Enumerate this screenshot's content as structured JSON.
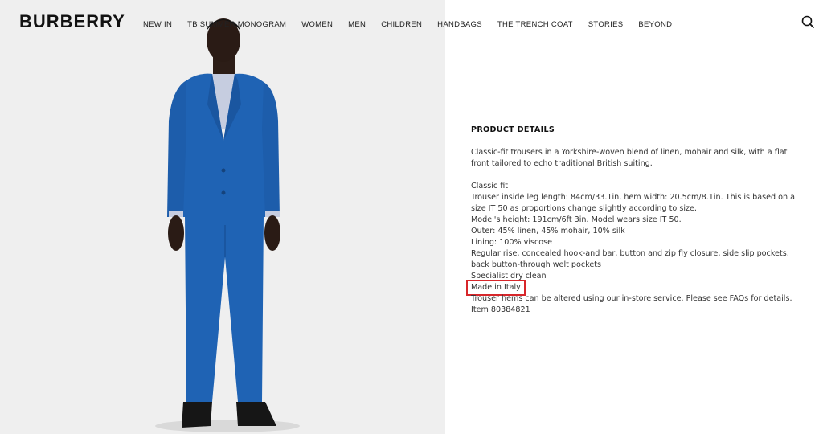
{
  "header": {
    "brand": "BURBERRY",
    "nav": [
      "NEW IN",
      "TB SUMMER MONOGRAM",
      "WOMEN",
      "MEN",
      "CHILDREN",
      "HANDBAGS",
      "THE TRENCH COAT",
      "STORIES",
      "BEYOND"
    ],
    "active_nav": "MEN",
    "search_icon": "search-icon"
  },
  "product_details": {
    "title": "PRODUCT DETAILS",
    "intro": "Classic-fit trousers in a Yorkshire-woven blend of linen, mohair and silk, with a flat front tailored to echo traditional British suiting.",
    "lines": [
      "Classic fit",
      "Trouser inside leg length: 84cm/33.1in, hem width: 20.5cm/8.1in. This is based on a size IT 50 as proportions change slightly according to size.",
      "Model's height: 191cm/6ft 3in. Model wears size IT 50.",
      "Outer: 45% linen, 45% mohair, 10% silk",
      "Lining: 100% viscose",
      "Regular rise, concealed hook-and bar, button and zip fly closure, side slip pockets, back button-through welt pockets",
      "Specialist dry clean",
      "Made in Italy",
      "Trouser hems can be altered using our in-store service. Please see FAQs for details.",
      "Item 80384821"
    ],
    "highlighted_line_index": 7,
    "highlight_color": "#d7262a"
  },
  "colors": {
    "suit": "#1f63b4",
    "hero_background": "#efefef"
  }
}
